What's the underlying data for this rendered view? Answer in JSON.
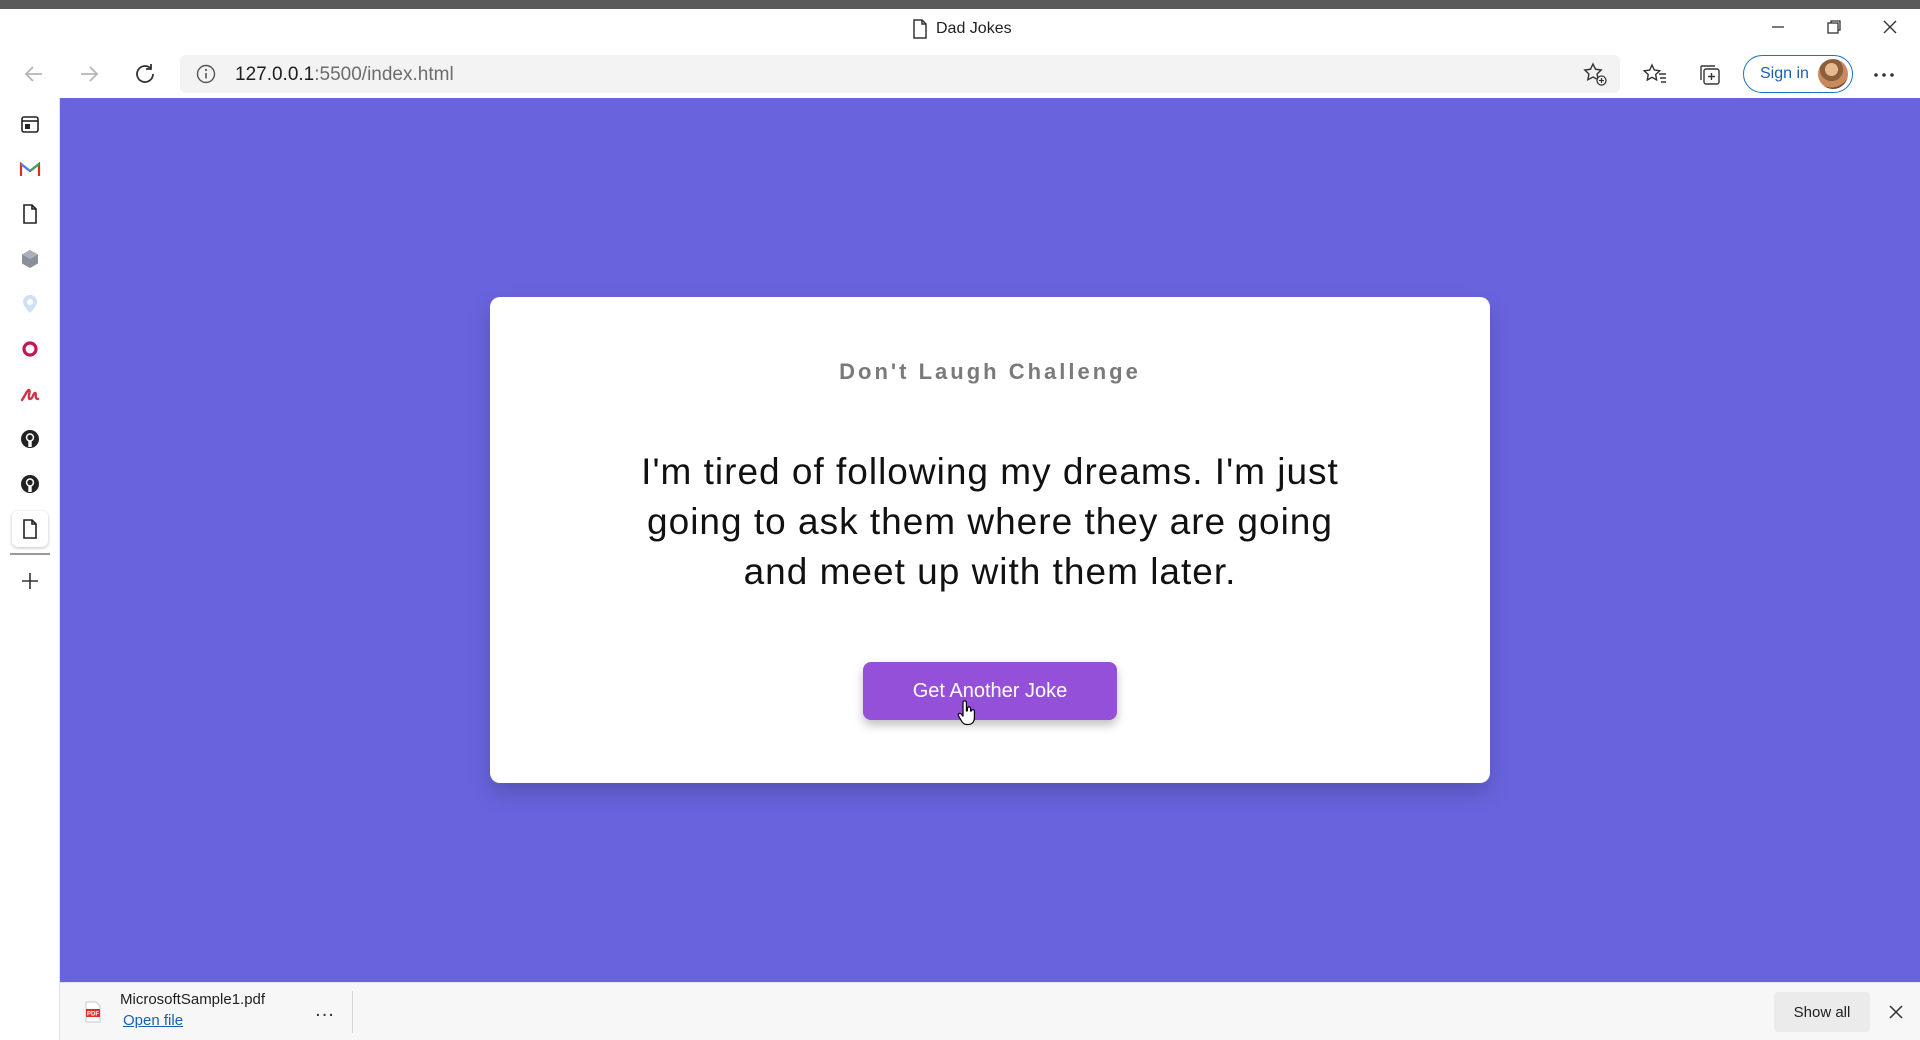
{
  "browser": {
    "tab_title": "Dad Jokes",
    "url_host": "127.0.0.1",
    "url_rest": ":5500/index.html",
    "signin_label": "Sign in"
  },
  "sidebar": {
    "items": [
      {
        "name": "outlook-calendar-icon"
      },
      {
        "name": "gmail-icon"
      },
      {
        "name": "document-icon"
      },
      {
        "name": "extension-icon"
      },
      {
        "name": "map-pin-icon"
      },
      {
        "name": "ring-app-icon"
      },
      {
        "name": "signature-app-icon"
      },
      {
        "name": "github-icon"
      },
      {
        "name": "github-icon"
      },
      {
        "name": "document-icon"
      }
    ]
  },
  "page": {
    "background": "#6964de",
    "heading": "Don't Laugh Challenge",
    "joke": "I'm tired of following my dreams. I'm just going to ask them where they are going and meet up with them later.",
    "button_label": "Get Another Joke",
    "button_color": "#9450d8"
  },
  "download": {
    "filename": "MicrosoftSample1.pdf",
    "open_label": "Open file",
    "more_label": "...",
    "show_all_label": "Show all"
  }
}
